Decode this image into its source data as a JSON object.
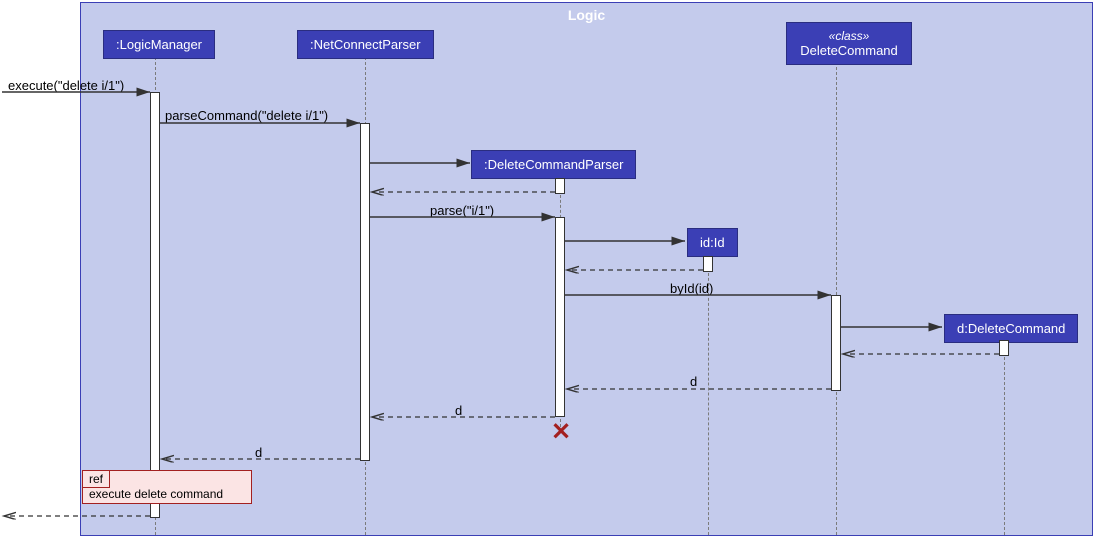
{
  "frame": {
    "title": "Logic"
  },
  "participants": {
    "logicManager": ":LogicManager",
    "netConnectParser": ":NetConnectParser",
    "deleteCommandParser": ":DeleteCommandParser",
    "id": "id:Id",
    "deleteCommandClass": {
      "stereotype": "«class»",
      "name": "DeleteCommand"
    },
    "deleteCommandInstance": "d:DeleteCommand"
  },
  "messages": {
    "execute": "execute(\"delete i/1\")",
    "parseCommand": "parseCommand(\"delete i/1\")",
    "parse": "parse(\"i/1\")",
    "byId": "byId(id)",
    "return_d1": "d",
    "return_d2": "d",
    "return_d3": "d"
  },
  "ref": {
    "label": "ref",
    "text": "execute delete command"
  }
}
